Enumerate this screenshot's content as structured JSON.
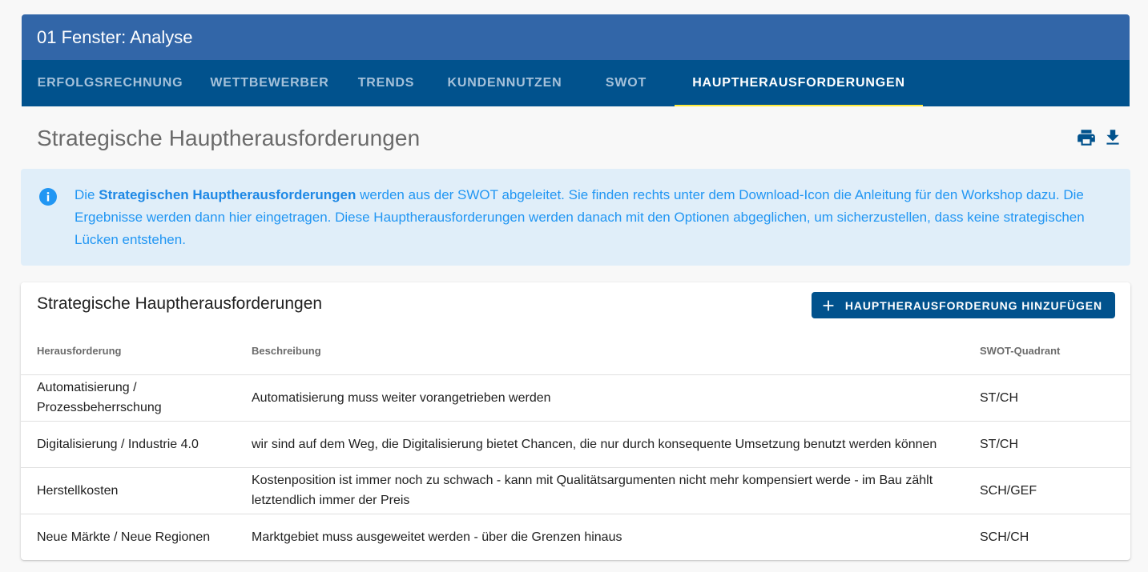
{
  "window": {
    "title": "01 Fenster: Analyse"
  },
  "tabs": [
    {
      "label": "Erfolgsrechnung",
      "active": false
    },
    {
      "label": "Wettbewerber",
      "active": false
    },
    {
      "label": "Trends",
      "active": false
    },
    {
      "label": "Kundennutzen",
      "active": false
    },
    {
      "label": "SWOT",
      "active": false
    },
    {
      "label": "Hauptherausforderungen",
      "active": true
    }
  ],
  "page": {
    "heading": "Strategische Hauptherausforderungen",
    "actions": {
      "print_icon": "print-icon",
      "download_icon": "download-icon"
    }
  },
  "info": {
    "icon": "info-icon",
    "prefix": "Die ",
    "bold": "Strategischen Hauptherausforderungen",
    "rest": " werden aus der SWOT abgeleitet. Sie finden rechts unter dem Download-Icon die Anleitung für den Workshop dazu. Die Ergebnisse werden dann hier eingetragen. Diese Hauptherausforderungen werden danach mit den Optionen abgeglichen, um sicherzustellen, dass keine strategischen Lücken entstehen."
  },
  "card": {
    "title": "Strategische Hauptherausforderungen",
    "add_button": "Hauptherausforderung hinzufügen",
    "columns": [
      "Herausforderung",
      "Beschreibung",
      "SWOT-Quadrant"
    ],
    "rows": [
      [
        "Automatisierung / Prozessbeherrschung",
        "Automatisierung muss weiter vorangetrieben werden",
        "ST/CH"
      ],
      [
        "Digitalisierung / Industrie 4.0",
        "wir sind auf dem Weg, die Digitalisierung bietet Chancen, die nur durch konsequente Umsetzung benutzt werden können",
        "ST/CH"
      ],
      [
        "Herstellkosten",
        "Kostenposition ist immer noch zu schwach - kann mit Qualitätsargumenten nicht mehr kompensiert werde - im Bau zählt letztendlich immer der Preis",
        "SCH/GEF"
      ],
      [
        "Neue Märkte / Neue Regionen",
        "Marktgebiet muss ausgeweitet werden - über die Grenzen hinaus",
        "SCH/CH"
      ]
    ]
  },
  "colors": {
    "title_bar": "#3266a8",
    "tab_bar": "#01528d",
    "tab_indicator": "#ffeb3b",
    "info_bg": "#e0eef9",
    "info_text": "#2196f3",
    "primary_button": "#01528d"
  }
}
